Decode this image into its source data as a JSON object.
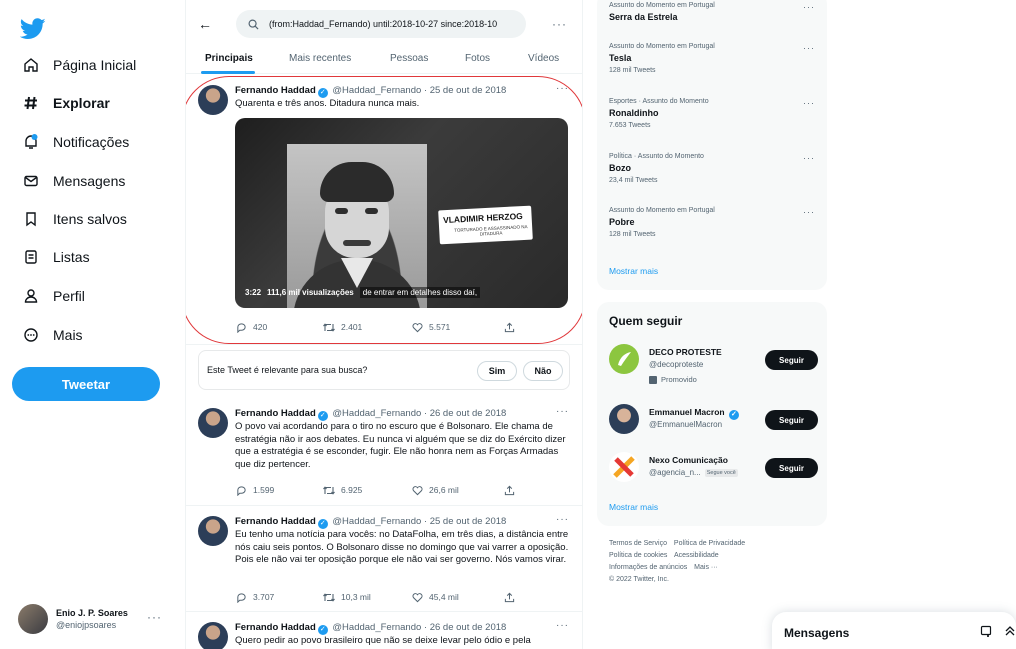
{
  "nav": {
    "items": [
      {
        "label": "Página Inicial",
        "icon": "home-icon"
      },
      {
        "label": "Explorar",
        "icon": "hashtag-icon"
      },
      {
        "label": "Notificações",
        "icon": "bell-icon"
      },
      {
        "label": "Mensagens",
        "icon": "mail-icon"
      },
      {
        "label": "Itens salvos",
        "icon": "bookmark-icon"
      },
      {
        "label": "Listas",
        "icon": "list-icon"
      },
      {
        "label": "Perfil",
        "icon": "person-icon"
      },
      {
        "label": "Mais",
        "icon": "more-circle-icon"
      }
    ],
    "tweet_button": "Tweetar"
  },
  "account": {
    "name": "Enio J. P. Soares",
    "handle": "@eniojpsoares"
  },
  "search": {
    "query": "(from:Haddad_Fernando) until:2018-10-27 since:2018-10"
  },
  "tabs": [
    "Principais",
    "Mais recentes",
    "Pessoas",
    "Fotos",
    "Vídeos"
  ],
  "tweets": [
    {
      "name": "Fernando Haddad",
      "meta": "@Haddad_Fernando · 25 de out de 2018",
      "text": "Quarenta e três anos. Ditadura nunca mais.",
      "replies": "420",
      "retweets": "2.401",
      "likes": "5.571",
      "media": {
        "caption_main": "VLADIMIR HERZOG",
        "caption_sub": "TORTURADO E ASSASSINADO NA DITADURA",
        "duration": "3:22",
        "views": "111,6 mil visualizações",
        "subtitle": "de entrar em detalhes disso daí,"
      }
    },
    {
      "name": "Fernando Haddad",
      "meta": "@Haddad_Fernando · 26 de out de 2018",
      "text": "O povo vai acordando para o tiro no escuro que é Bolsonaro. Ele chama de estratégia não ir aos debates. Eu nunca vi alguém que se diz do Exército dizer que a estratégia é se esconder, fugir. Ele não honra nem as Forças Armadas que diz pertencer.",
      "replies": "1.599",
      "retweets": "6.925",
      "likes": "26,6 mil"
    },
    {
      "name": "Fernando Haddad",
      "meta": "@Haddad_Fernando · 25 de out de 2018",
      "text": "Eu tenho uma notícia para vocês: no DataFolha, em três dias, a distância entre nós caiu seis pontos. O Bolsonaro disse no domingo que vai varrer a oposição. Pois ele não vai ter oposição porque ele não vai ser governo. Nós vamos virar.",
      "replies": "3.707",
      "retweets": "10,3 mil",
      "likes": "45,4 mil"
    },
    {
      "name": "Fernando Haddad",
      "meta": "@Haddad_Fernando · 26 de out de 2018",
      "text": "Quero pedir ao povo brasileiro que não se deixe levar pelo ódio e pela"
    }
  ],
  "feedback": {
    "question": "Este Tweet é relevante para sua busca?",
    "yes": "Sim",
    "no": "Não"
  },
  "trends": [
    {
      "category": "Assunto do Momento em Portugal",
      "name": "Serra da Estrela",
      "count": ""
    },
    {
      "category": "Assunto do Momento em Portugal",
      "name": "Tesla",
      "count": "128 mil Tweets"
    },
    {
      "category": "Esportes · Assunto do Momento",
      "name": "Ronaldinho",
      "count": "7.653 Tweets"
    },
    {
      "category": "Política · Assunto do Momento",
      "name": "Bozo",
      "count": "23,4 mil Tweets"
    },
    {
      "category": "Assunto do Momento em Portugal",
      "name": "Pobre",
      "count": "128 mil Tweets"
    }
  ],
  "trends_show_more": "Mostrar mais",
  "who_to_follow": {
    "title": "Quem seguir",
    "accounts": [
      {
        "name": "DECO PROTESTE",
        "handle": "@decoproteste",
        "promoted": "Promovido",
        "button": "Seguir"
      },
      {
        "name": "Emmanuel Macron",
        "handle": "@EmmanuelMacron",
        "button": "Seguir"
      },
      {
        "name": "Nexo Comunicação",
        "handle": "@agencia_n...",
        "follows_you": "Segue você",
        "button": "Seguir"
      }
    ],
    "show_more": "Mostrar mais"
  },
  "footer": {
    "links": [
      "Termos de Serviço",
      "Política de Privacidade",
      "Política de cookies",
      "Acessibilidade",
      "Informações de anúncios",
      "Mais ···"
    ],
    "copyright": "© 2022 Twitter, Inc."
  },
  "messages_drawer": {
    "title": "Mensagens"
  },
  "colors": {
    "accent": "#1d9bf0",
    "highlight_ring": "#e0383b",
    "text": "#0f1419",
    "secondary": "#536471"
  }
}
